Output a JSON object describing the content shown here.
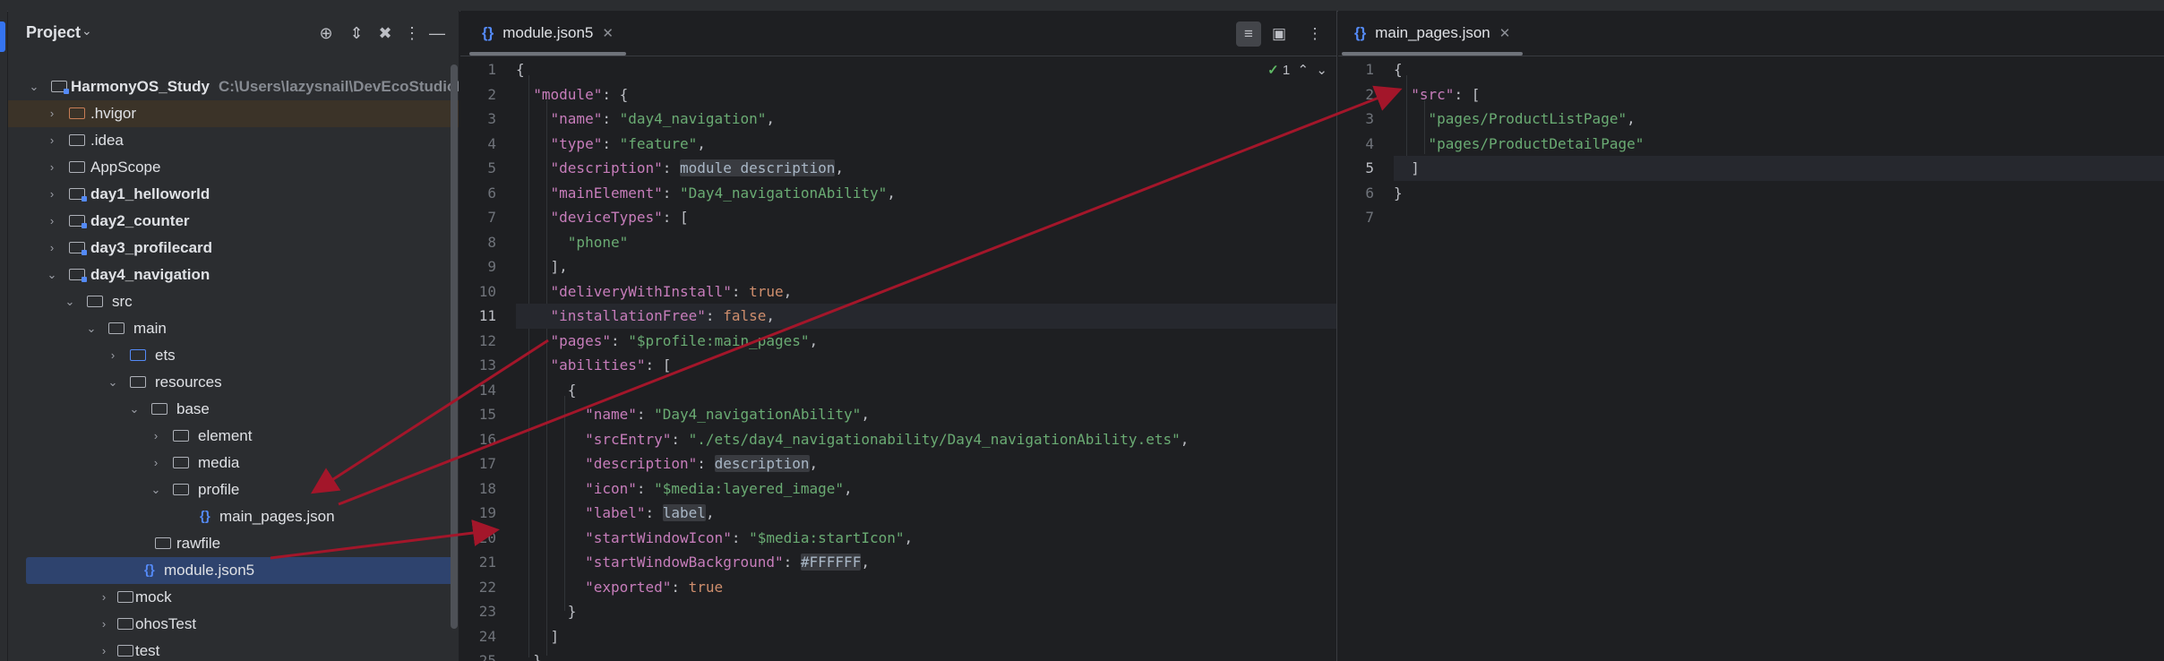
{
  "project_panel": {
    "title": "Project",
    "tree": [
      {
        "label": "HarmonyOS_Study",
        "path": "C:\\Users\\lazysnail\\DevEcoStudioProjects"
      },
      {
        "label": ".hvigor"
      },
      {
        "label": ".idea"
      },
      {
        "label": "AppScope"
      },
      {
        "label": "day1_helloworld"
      },
      {
        "label": "day2_counter"
      },
      {
        "label": "day3_profilecard"
      },
      {
        "label": "day4_navigation"
      },
      {
        "label": "src"
      },
      {
        "label": "main"
      },
      {
        "label": "ets"
      },
      {
        "label": "resources"
      },
      {
        "label": "base"
      },
      {
        "label": "element"
      },
      {
        "label": "media"
      },
      {
        "label": "profile"
      },
      {
        "label": "main_pages.json"
      },
      {
        "label": "rawfile"
      },
      {
        "label": "module.json5"
      },
      {
        "label": "mock"
      },
      {
        "label": "ohosTest"
      },
      {
        "label": "test"
      }
    ]
  },
  "left_editor": {
    "tab": "module.json5",
    "inspection_count": "1",
    "line_numbers": [
      "1",
      "2",
      "3",
      "4",
      "5",
      "6",
      "7",
      "8",
      "9",
      "10",
      "11",
      "12",
      "13",
      "14",
      "15",
      "16",
      "17",
      "18",
      "19",
      "20",
      "21",
      "22",
      "23",
      "24",
      "25"
    ]
  },
  "right_editor": {
    "tab": "main_pages.json",
    "line_numbers": [
      "1",
      "2",
      "3",
      "4",
      "5",
      "6",
      "7"
    ]
  },
  "colors": {
    "accent": "#3574f0",
    "arrow": "#a3162a",
    "string": "#6aab73",
    "key": "#c77dbb",
    "keyword": "#cf8e6d"
  }
}
